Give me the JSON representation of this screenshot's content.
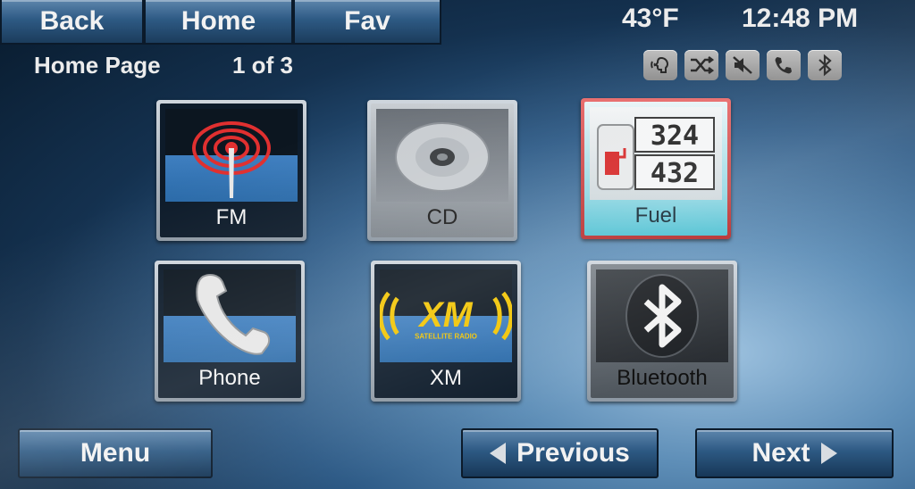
{
  "nav": {
    "back": "Back",
    "home": "Home",
    "fav": "Fav"
  },
  "status": {
    "temperature": "43°F",
    "time": "12:48 PM"
  },
  "page": {
    "title": "Home Page",
    "count": "1 of 3"
  },
  "status_icons": [
    "voice-icon",
    "shuffle-icon",
    "mute-icon",
    "phone-icon",
    "bluetooth-icon"
  ],
  "tiles": [
    {
      "label": "FM",
      "icon": "radio-tower-icon"
    },
    {
      "label": "CD",
      "icon": "cd-icon"
    },
    {
      "label": "Fuel",
      "icon": "fuel-icon",
      "readout_top": "324",
      "readout_bottom": "432"
    },
    {
      "label": "Phone",
      "icon": "phone-handset-icon"
    },
    {
      "label": "XM",
      "icon": "xm-logo-icon",
      "logo_text": "XM",
      "logo_subtext": "SATELLITE RADIO"
    },
    {
      "label": "Bluetooth",
      "icon": "bluetooth-icon"
    }
  ],
  "bottom": {
    "menu": "Menu",
    "previous": "Previous",
    "next": "Next"
  },
  "colors": {
    "button_blue": "#2e5a84",
    "fm_red": "#e03030",
    "xm_yellow": "#f2c400",
    "fuel_border": "#d84848"
  }
}
